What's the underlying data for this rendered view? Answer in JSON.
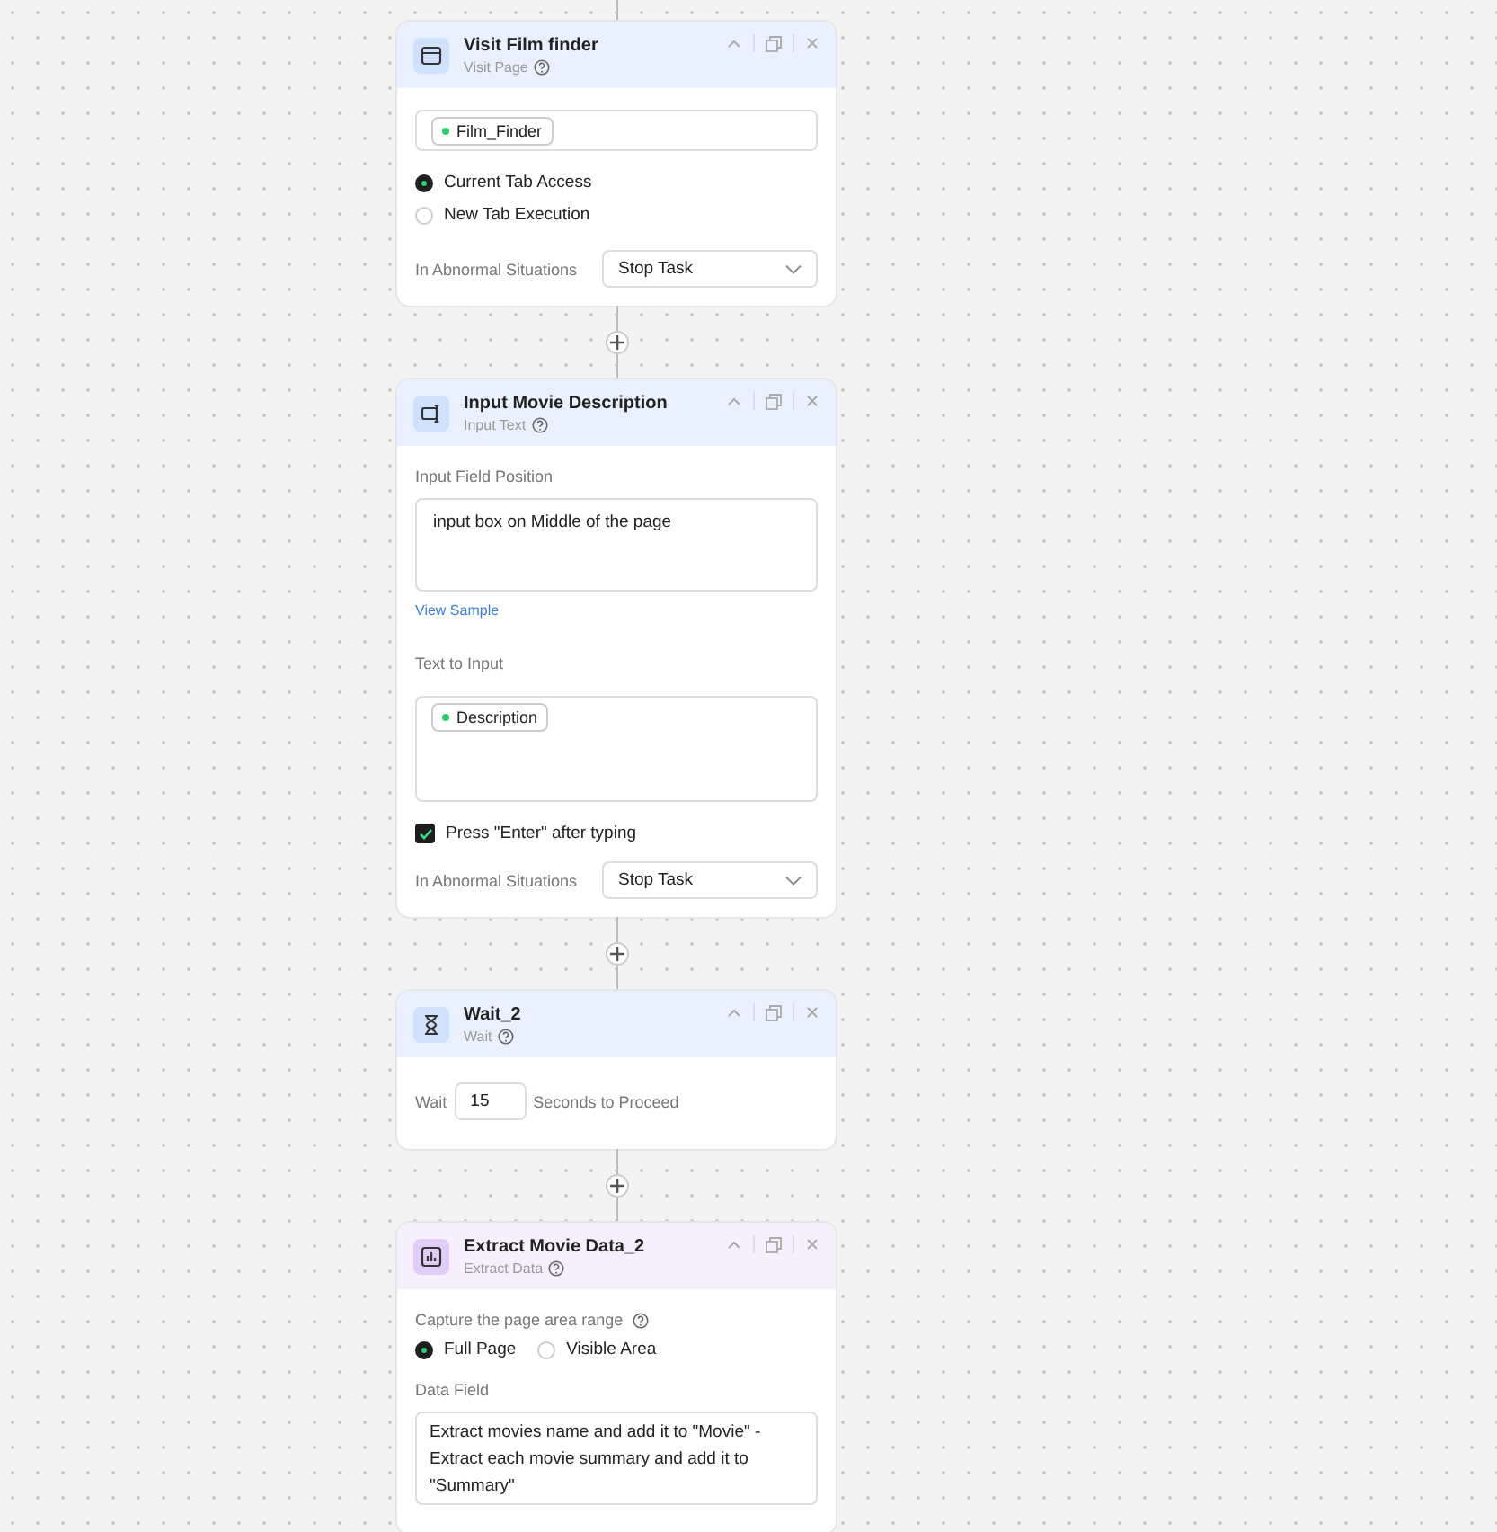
{
  "nodes": [
    {
      "kind": "visit",
      "title": "Visit Film finder",
      "subtitle": "Visit Page",
      "fields": [
        {
          "kind": "tag-field",
          "tag": "Film_Finder"
        },
        {
          "kind": "radio-list",
          "options": [
            {
              "label": "Current Tab Access",
              "selected": true
            },
            {
              "label": "New Tab Execution",
              "selected": false
            }
          ]
        },
        {
          "kind": "select",
          "label": "In Abnormal Situations",
          "value": "Stop Task"
        }
      ]
    },
    {
      "kind": "input",
      "title": "Input Movie Description",
      "subtitle": "Input Text",
      "fields": [
        {
          "kind": "label",
          "text": "Input Field Position"
        },
        {
          "kind": "textarea",
          "value": "input box on Middle of the page"
        },
        {
          "kind": "link",
          "text": "View Sample"
        },
        {
          "kind": "label",
          "text": "Text to Input"
        },
        {
          "kind": "tag-area",
          "tag": "Description"
        },
        {
          "kind": "checkbox",
          "label": "Press \"Enter\" after typing",
          "checked": true
        },
        {
          "kind": "select",
          "label": "In Abnormal Situations",
          "value": "Stop Task"
        }
      ]
    },
    {
      "kind": "wait",
      "title": "Wait_2",
      "subtitle": "Wait",
      "fields": [
        {
          "kind": "wait-row",
          "label": "Wait",
          "value": "15",
          "suffix": "Seconds to Proceed"
        }
      ]
    },
    {
      "kind": "extract",
      "title": "Extract Movie Data_2",
      "subtitle": "Extract Data",
      "fields": [
        {
          "kind": "help-label",
          "text": "Capture the page area range"
        },
        {
          "kind": "radio-inline",
          "options": [
            {
              "label": "Full Page",
              "selected": true
            },
            {
              "label": "Visible Area",
              "selected": false
            }
          ]
        },
        {
          "kind": "label",
          "text": "Data Field"
        },
        {
          "kind": "textarea",
          "value": "Extract movies name and add it to \"Movie\" - Extract each movie summary and add it to \"Summary\""
        }
      ]
    }
  ]
}
